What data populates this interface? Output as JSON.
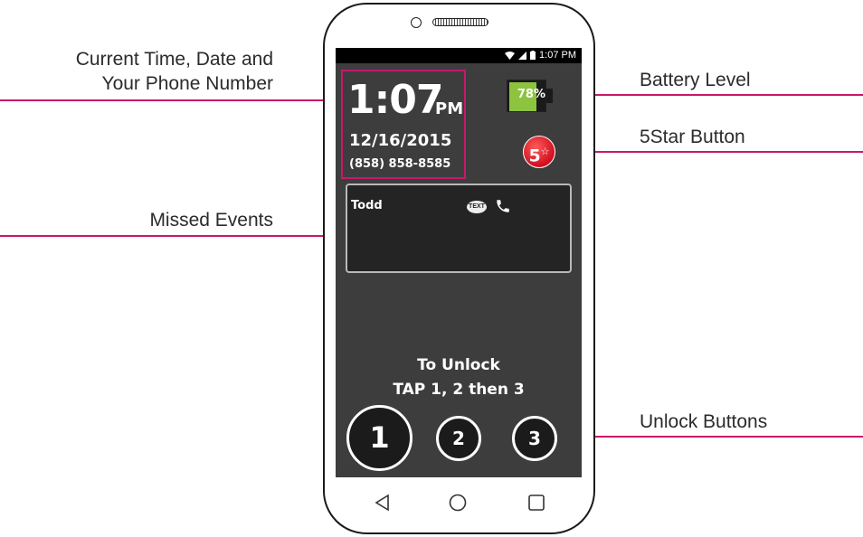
{
  "callouts": {
    "time_date_line1": "Current Time, Date and",
    "time_date_line2": "Your Phone Number",
    "missed_events": "Missed Events",
    "battery_level": "Battery Level",
    "fivestar_button": "5Star Button",
    "unlock_buttons": "Unlock Buttons"
  },
  "status_bar": {
    "time": "1:07 PM",
    "icons": [
      "wifi-icon",
      "signal-icon",
      "battery-icon"
    ]
  },
  "lock_screen": {
    "time": "1:07",
    "ampm": "PM",
    "date": "12/16/2015",
    "phone_number": "(858) 858-8585",
    "battery_percent": "78%",
    "battery_level": 0.78,
    "fivestar_label": "5",
    "fivestar_star": "☆",
    "missed_event": {
      "name": "Todd",
      "text_icon_label": "TEXT",
      "icons": [
        "text-message-icon",
        "phone-call-icon"
      ]
    },
    "unlock_instruction_line1": "To Unlock",
    "unlock_instruction_line2": "TAP 1, 2 then 3",
    "unlock_buttons": [
      "1",
      "2",
      "3"
    ]
  },
  "navigation": {
    "icons": [
      "back-icon",
      "home-icon",
      "recents-icon"
    ]
  },
  "colors": {
    "callout_line": "#c8186c",
    "battery_fill": "#8cc33f",
    "fivestar": "#d10f1f",
    "screen_bg": "#3d3d3d"
  }
}
